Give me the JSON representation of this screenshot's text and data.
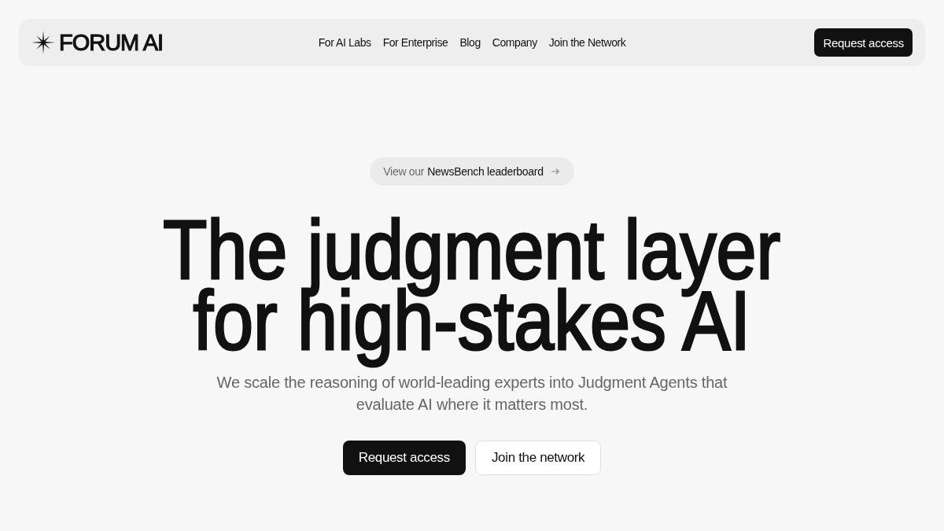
{
  "header": {
    "logo_text": "FORUM AI",
    "nav_links": [
      "For AI Labs",
      "For Enterprise",
      "Blog",
      "Company",
      "Join the Network"
    ],
    "cta": "Request access"
  },
  "hero": {
    "announcement": {
      "prefix": "View our",
      "link": "NewsBench leaderboard"
    },
    "headline_lines": [
      "The judgment layer",
      "for high-stakes AI"
    ],
    "subtitle": "We scale the reasoning of world-leading experts into Judgment Agents that evaluate AI where it matters most.",
    "buttons": [
      {
        "label": "Request access",
        "kind": "primary"
      },
      {
        "label": "Join the network",
        "kind": "secondary"
      }
    ]
  }
}
